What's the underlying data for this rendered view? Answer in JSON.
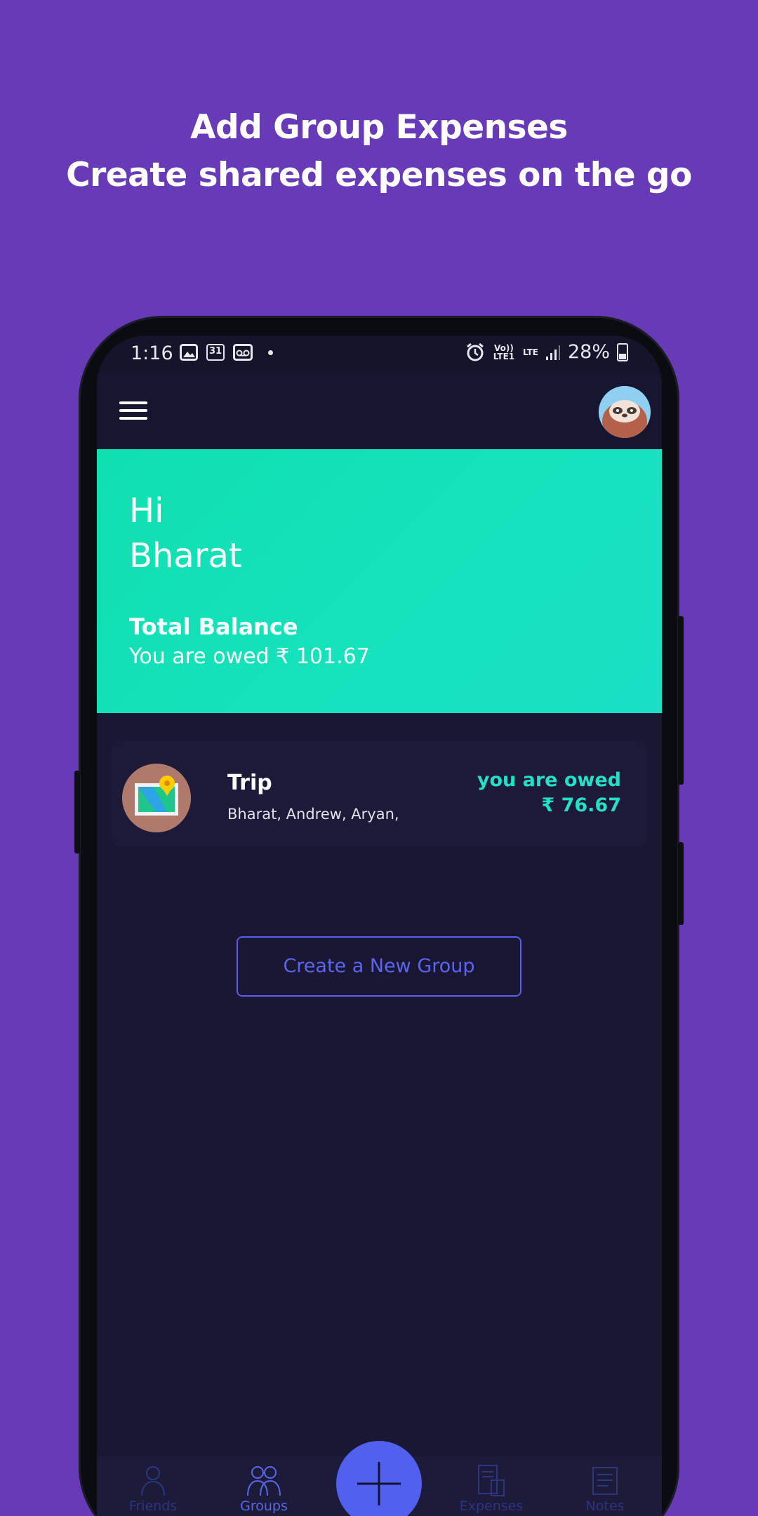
{
  "headline": {
    "line1": "Add Group Expenses",
    "line2": "Create shared expenses on the go"
  },
  "status_bar": {
    "time": "1:16",
    "calendar_day": "31",
    "network": "Vo)) LTE1",
    "lte": "LTE",
    "battery": "28%"
  },
  "hero": {
    "greeting_line1": "Hi",
    "greeting_line2": "Bharat",
    "balance_title": "Total Balance",
    "balance_text": "You are owed ₹ 101.67"
  },
  "groups": [
    {
      "name": "Trip",
      "members": "Bharat, Andrew, Aryan,",
      "status": "you are owed",
      "amount": "₹ 76.67"
    }
  ],
  "create_group_label": "Create a New Group",
  "bottom_nav": {
    "friends": "Friends",
    "groups": "Groups",
    "expenses": "Expenses",
    "notes": "Notes"
  },
  "colors": {
    "background": "#673ab7",
    "screen": "#191733",
    "accent_teal": "#16e2bd",
    "accent_blue": "#5160ee"
  }
}
